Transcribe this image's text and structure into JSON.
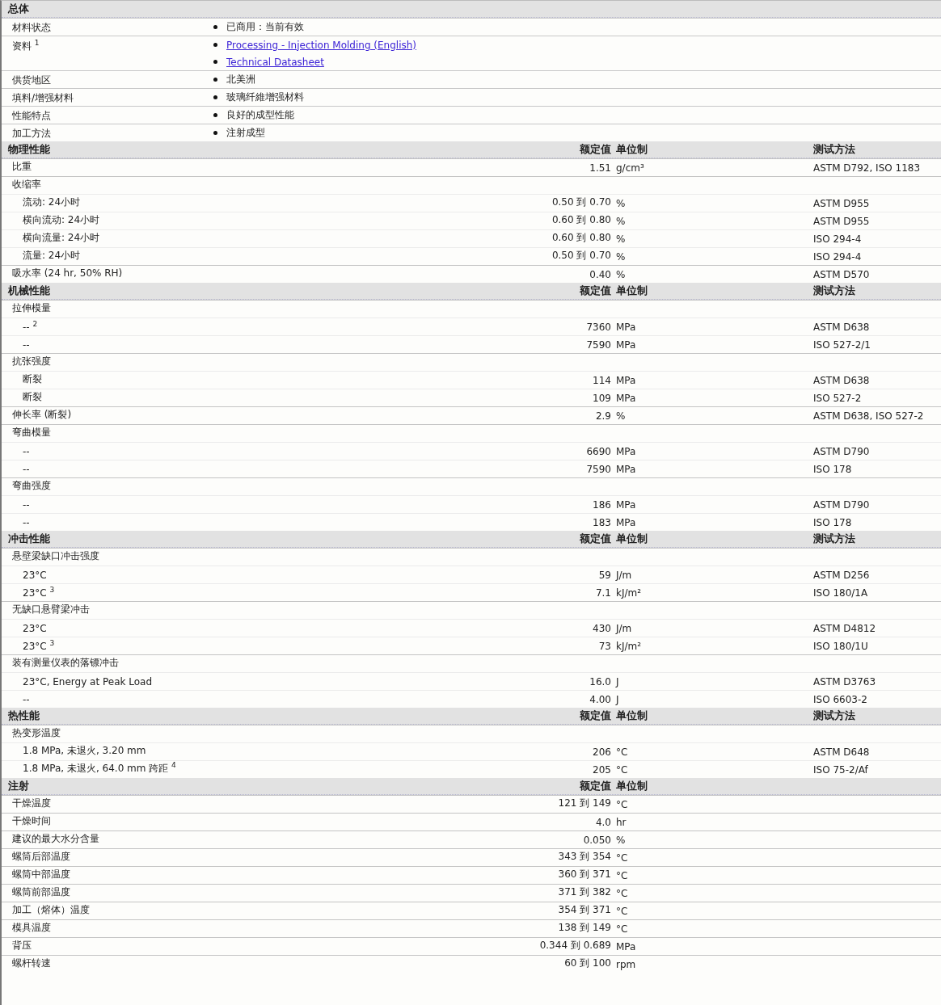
{
  "general": {
    "title": "总体",
    "rows": [
      {
        "label": "材料状态",
        "items": [
          {
            "kind": "text",
            "text": "已商用：当前有效"
          }
        ]
      },
      {
        "label": "资料 $^{1}$",
        "items": [
          {
            "kind": "link",
            "text": "Processing - Injection Molding (English)"
          },
          {
            "kind": "link",
            "text": "Technical Datasheet"
          }
        ]
      },
      {
        "label": "供货地区",
        "items": [
          {
            "kind": "text",
            "text": "北美洲"
          }
        ]
      },
      {
        "label": "填料/增强材料",
        "items": [
          {
            "kind": "text",
            "text": "玻璃纤維增强材料"
          }
        ]
      },
      {
        "label": "性能特点",
        "items": [
          {
            "kind": "text",
            "text": "良好的成型性能"
          }
        ]
      },
      {
        "label": "加工方法",
        "items": [
          {
            "kind": "text",
            "text": "注射成型"
          }
        ]
      }
    ]
  },
  "sections": [
    {
      "title": "物理性能",
      "value_header": "额定值",
      "unit_header": "单位制",
      "method_header": "测试方法",
      "rows": [
        {
          "label": "比重",
          "value": "1.51",
          "unit": "g/cm³",
          "method": "ASTM D792, ISO 1183"
        },
        {
          "label": "收缩率",
          "children": [
            {
              "label": "流动: 24小时",
              "value": "0.50 到 0.70",
              "unit": "%",
              "method": "ASTM D955"
            },
            {
              "label": "横向流动: 24小时",
              "value": "0.60 到 0.80",
              "unit": "%",
              "method": "ASTM D955"
            },
            {
              "label": "横向流量: 24小时",
              "value": "0.60 到 0.80",
              "unit": "%",
              "method": "ISO 294-4"
            },
            {
              "label": "流量: 24小时",
              "value": "0.50 到 0.70",
              "unit": "%",
              "method": "ISO 294-4"
            }
          ]
        },
        {
          "label": "吸水率 (24 hr, 50% RH)",
          "value": "0.40",
          "unit": "%",
          "method": "ASTM D570"
        }
      ]
    },
    {
      "title": "机械性能",
      "value_header": "额定值",
      "unit_header": "单位制",
      "method_header": "测试方法",
      "rows": [
        {
          "label": "拉伸模量",
          "children": [
            {
              "label": "-- $^{2}$",
              "value": "7360",
              "unit": "MPa",
              "method": "ASTM D638"
            },
            {
              "label": "--",
              "value": "7590",
              "unit": "MPa",
              "method": "ISO 527-2/1"
            }
          ]
        },
        {
          "label": "抗张强度",
          "children": [
            {
              "label": "断裂",
              "value": "114",
              "unit": "MPa",
              "method": "ASTM D638"
            },
            {
              "label": "断裂",
              "value": "109",
              "unit": "MPa",
              "method": "ISO 527-2"
            }
          ]
        },
        {
          "label": "伸长率 (断裂)",
          "value": "2.9",
          "unit": "%",
          "method": "ASTM D638, ISO 527-2"
        },
        {
          "label": "弯曲模量",
          "children": [
            {
              "label": "--",
              "value": "6690",
              "unit": "MPa",
              "method": "ASTM D790"
            },
            {
              "label": "--",
              "value": "7590",
              "unit": "MPa",
              "method": "ISO 178"
            }
          ]
        },
        {
          "label": "弯曲强度",
          "children": [
            {
              "label": "--",
              "value": "186",
              "unit": "MPa",
              "method": "ASTM D790"
            },
            {
              "label": "--",
              "value": "183",
              "unit": "MPa",
              "method": "ISO 178"
            }
          ]
        }
      ]
    },
    {
      "title": "冲击性能",
      "value_header": "额定值",
      "unit_header": "单位制",
      "method_header": "测试方法",
      "rows": [
        {
          "label": "悬壁梁缺口冲击强度",
          "children": [
            {
              "label": "23°C",
              "value": "59",
              "unit": "J/m",
              "method": "ASTM D256"
            },
            {
              "label": "23°C $^{3}$",
              "value": "7.1",
              "unit": "kJ/m²",
              "method": "ISO 180/1A"
            }
          ]
        },
        {
          "label": "无缺口悬臂梁冲击",
          "children": [
            {
              "label": "23°C",
              "value": "430",
              "unit": "J/m",
              "method": "ASTM D4812"
            },
            {
              "label": "23°C $^{3}$",
              "value": "73",
              "unit": "kJ/m²",
              "method": "ISO 180/1U"
            }
          ]
        },
        {
          "label": "装有测量仪表的落镖冲击",
          "children": [
            {
              "label": "23°C, Energy at Peak Load",
              "value": "16.0",
              "unit": "J",
              "method": "ASTM D3763"
            },
            {
              "label": "--",
              "value": "4.00",
              "unit": "J",
              "method": "ISO 6603-2"
            }
          ]
        }
      ]
    },
    {
      "title": "热性能",
      "value_header": "额定值",
      "unit_header": "单位制",
      "method_header": "测试方法",
      "rows": [
        {
          "label": "热变形温度",
          "children": [
            {
              "label": "1.8 MPa, 未退火, 3.20 mm",
              "value": "206",
              "unit": "°C",
              "method": "ASTM D648"
            },
            {
              "label": "1.8 MPa, 未退火, 64.0 mm 跨距 $^{4}$",
              "value": "205",
              "unit": "°C",
              "method": "ISO 75-2/Af"
            }
          ]
        }
      ]
    },
    {
      "title": "注射",
      "value_header": "额定值",
      "unit_header": "单位制",
      "rows": [
        {
          "label": "干燥温度",
          "value": "121 到 149",
          "unit": "°C"
        },
        {
          "label": "干燥时间",
          "value": "4.0",
          "unit": "hr"
        },
        {
          "label": "建议的最大水分含量",
          "value": "0.050",
          "unit": "%"
        },
        {
          "label": "螺筒后部温度",
          "value": "343 到 354",
          "unit": "°C"
        },
        {
          "label": "螺筒中部温度",
          "value": "360 到 371",
          "unit": "°C"
        },
        {
          "label": "螺筒前部温度",
          "value": "371 到 382",
          "unit": "°C"
        },
        {
          "label": "加工（熔体）温度",
          "value": "354 到 371",
          "unit": "°C"
        },
        {
          "label": "模具温度",
          "value": "138 到 149",
          "unit": "°C"
        },
        {
          "label": "背压",
          "value": "0.344 到 0.689",
          "unit": "MPa"
        },
        {
          "label": "螺杆转速",
          "value": "60 到 100",
          "unit": "rpm"
        }
      ]
    }
  ]
}
